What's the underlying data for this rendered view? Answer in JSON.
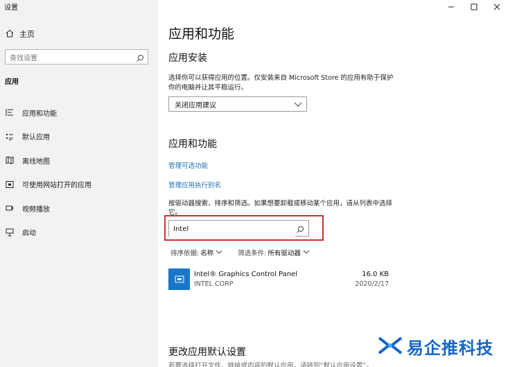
{
  "window": {
    "title": "设置"
  },
  "sidebar": {
    "home_label": "主页",
    "search_placeholder": "查找设置",
    "section": "应用",
    "items": [
      {
        "label": "应用和功能",
        "icon": "list-icon"
      },
      {
        "label": "默认应用",
        "icon": "default-apps-icon"
      },
      {
        "label": "离线地图",
        "icon": "map-icon"
      },
      {
        "label": "可使用网站打开的应用",
        "icon": "website-app-icon"
      },
      {
        "label": "视频播放",
        "icon": "video-icon"
      },
      {
        "label": "启动",
        "icon": "startup-icon"
      }
    ]
  },
  "main": {
    "title": "应用和功能",
    "install": {
      "heading": "应用安装",
      "description": "选择你可以获得应用的位置。仅安装来自 Microsoft Store 的应用有助于保护你的电脑并让其平稳运行。",
      "dropdown_value": "关闭应用建议"
    },
    "apps": {
      "heading": "应用和功能",
      "link_optional": "管理可选功能",
      "link_alias": "管理应用执行别名",
      "description": "按驱动器搜索、排序和筛选。如果想要卸载或移动某个应用，请从列表中选择它。",
      "search_value": "Intel",
      "sort_label": "排序依据:",
      "sort_value": "名称",
      "filter_label": "筛选条件:",
      "filter_value": "所有驱动器",
      "list": [
        {
          "name": "Intel® Graphics Control Panel",
          "publisher": "INTEL CORP",
          "size": "16.0 KB",
          "date": "2020/2/17"
        }
      ]
    },
    "default": {
      "heading": "更改应用默认设置",
      "description": "若要选择打开文件、链接或内容的默认应用，请转到“默认应用设置”。"
    }
  },
  "watermark": {
    "text": "易企推科技"
  },
  "colors": {
    "accent": "#1a6fb4",
    "highlight": "#d03030",
    "sidebar_bg": "#f2f2f2"
  }
}
